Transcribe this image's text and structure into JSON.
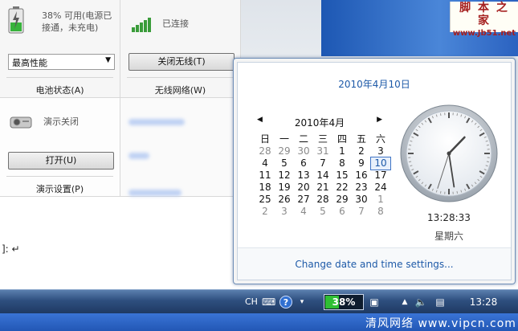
{
  "mobility_center": {
    "battery": {
      "status": "38% 可用(电源已\n接通，未充电)",
      "status_line1": "38% 可用(电源已",
      "status_line2": "接通，未充电)",
      "plan_selected": "最高性能",
      "title": "电池状态(A)"
    },
    "wireless": {
      "status": "已连接",
      "button": "关闭无线(T)",
      "title": "无线网络(W)"
    },
    "presentation": {
      "status": "演示关闭",
      "button": "打开(U)",
      "title": "演示设置(P)"
    }
  },
  "document": {
    "text": "]: ↵"
  },
  "watermark": {
    "title": "脚 本 之 家",
    "url": "www.Jb51.net"
  },
  "flyout": {
    "date_header": "2010年4月10日",
    "calendar": {
      "month_label": "2010年4月",
      "weekday_headers": [
        "日",
        "一",
        "二",
        "三",
        "四",
        "五",
        "六"
      ],
      "weeks": [
        [
          "28",
          "29",
          "30",
          "31",
          "1",
          "2",
          "3"
        ],
        [
          "4",
          "5",
          "6",
          "7",
          "8",
          "9",
          "10"
        ],
        [
          "11",
          "12",
          "13",
          "14",
          "15",
          "16",
          "17"
        ],
        [
          "18",
          "19",
          "20",
          "21",
          "22",
          "23",
          "24"
        ],
        [
          "25",
          "26",
          "27",
          "28",
          "29",
          "30",
          "1"
        ],
        [
          "2",
          "3",
          "4",
          "5",
          "6",
          "7",
          "8"
        ]
      ],
      "today": "10"
    },
    "clock_time": "13:28:33",
    "weekday": "星期六",
    "settings_link": "Change date and time settings..."
  },
  "taskbar": {
    "language": "CH",
    "battery_percent": "38%",
    "battery_level": 0.38,
    "clock": "13:28"
  },
  "banner": {
    "text": "清风网络  www.vipcn.com"
  }
}
